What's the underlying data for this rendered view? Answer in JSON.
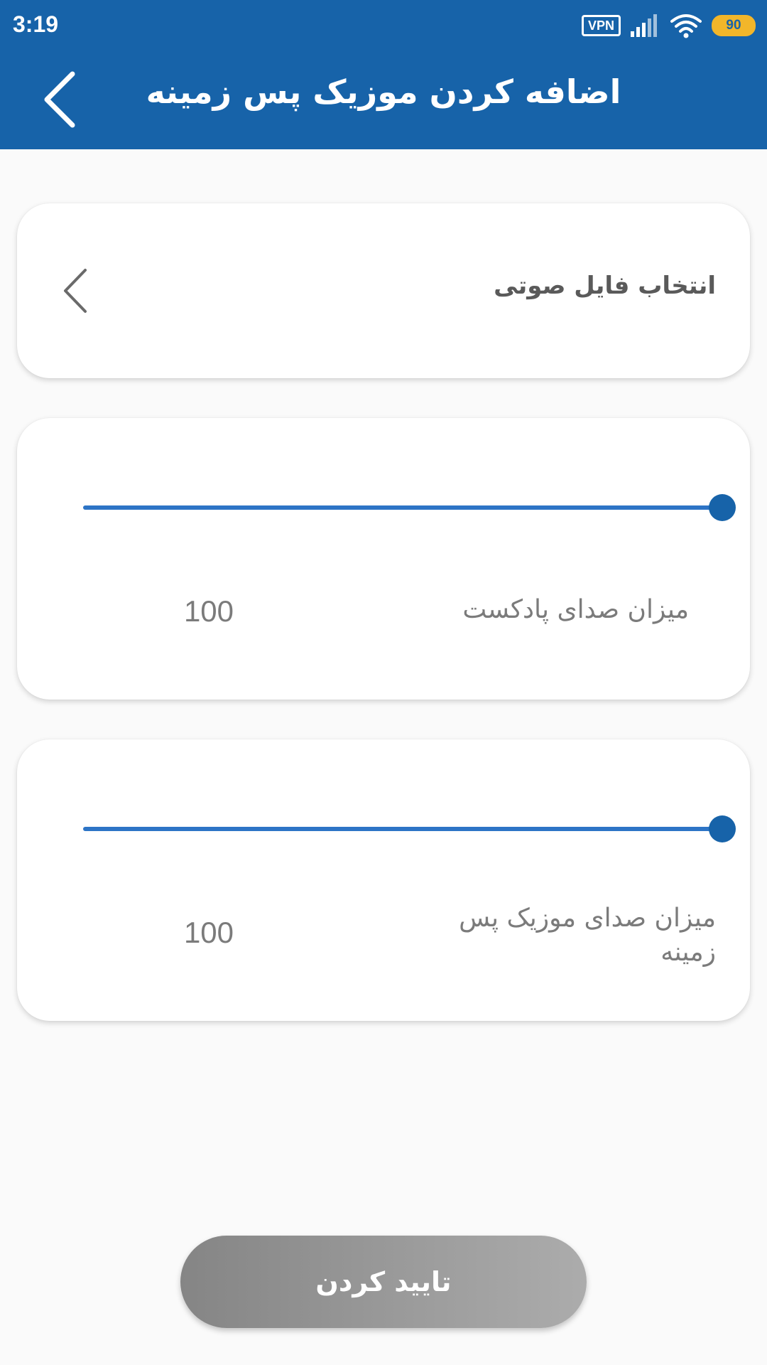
{
  "status_bar": {
    "time": "3:19",
    "vpn_label": "VPN",
    "battery_level": "90",
    "icons": [
      "vpn-icon",
      "signal-icon",
      "wifi-icon",
      "battery-icon"
    ]
  },
  "header": {
    "title": "اضافه کردن موزیک پس زمینه",
    "back_icon": "back-arrow-icon"
  },
  "audio_file": {
    "label": "انتخاب فایل صوتی",
    "icon": "chevron-left-icon"
  },
  "podcast_volume": {
    "label": "میزان صدای پادکست",
    "value": "100",
    "level_fraction": 1.0
  },
  "music_volume": {
    "label": "میزان صدای موزیک پس زمینه",
    "value": "100",
    "level_fraction": 1.0
  },
  "confirm": {
    "label": "تایید کردن"
  },
  "colors": {
    "primary": "#1763a9",
    "slider_track": "#2d74c6",
    "background": "#fafafa",
    "battery": "#f2b62a",
    "button_gradient_start": "#858585",
    "button_gradient_end": "#acacac"
  }
}
